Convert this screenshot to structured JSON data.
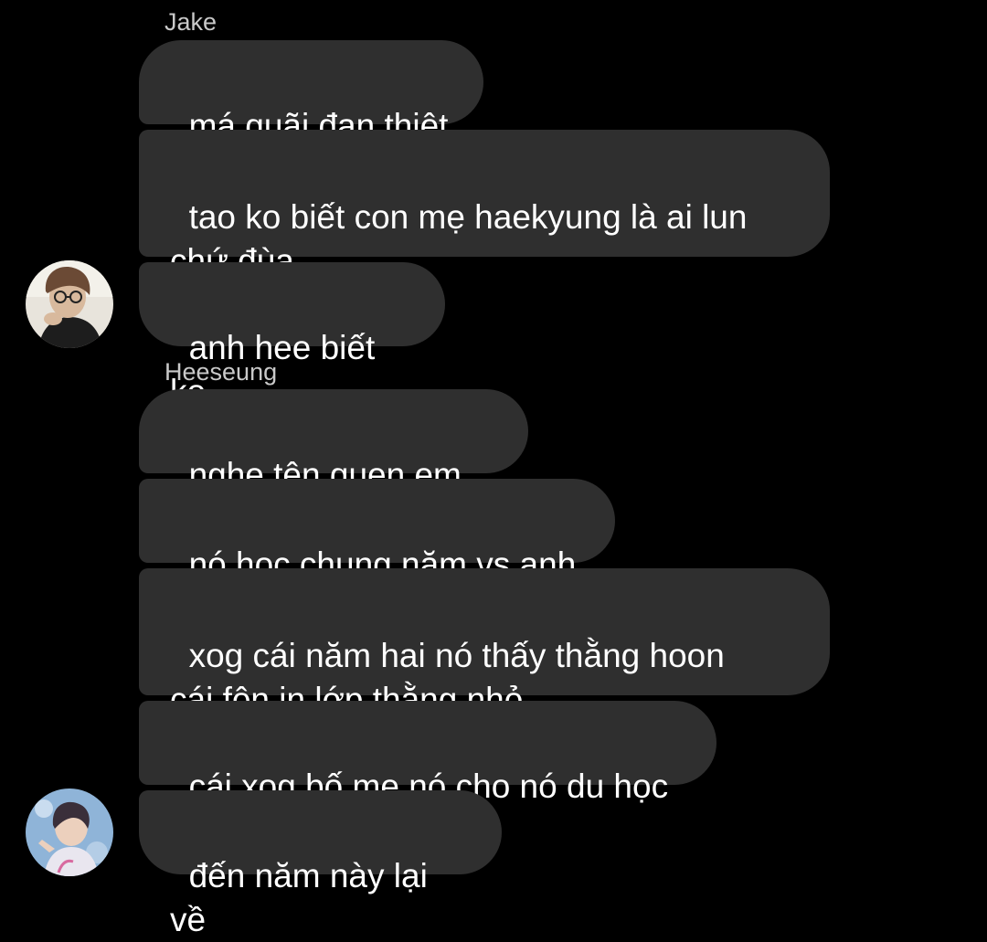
{
  "groups": [
    {
      "sender": "Jake",
      "messages": [
        "má quãi đạn thiệt",
        "tao ko biết con mẹ haekyung là ai lun\nchứ đùa",
        "anh hee biết ko"
      ],
      "avatar_icon": "person-with-glasses-avatar"
    },
    {
      "sender": "Heeseung",
      "messages": [
        "nghe tên quen em ơi",
        "nó học chung năm vs anh",
        "xog cái năm hai nó thấy thằng hoon\ncái fôn in lớp thằng nhỏ",
        "cái xog bố mẹ nó cho nó du học",
        "đến năm này lại về"
      ],
      "avatar_icon": "person-blue-background-avatar"
    }
  ],
  "colors": {
    "background": "#000000",
    "bubble": "#2f2f2f",
    "bubble_text": "#ffffff",
    "sender_text": "#c9c9c9"
  }
}
